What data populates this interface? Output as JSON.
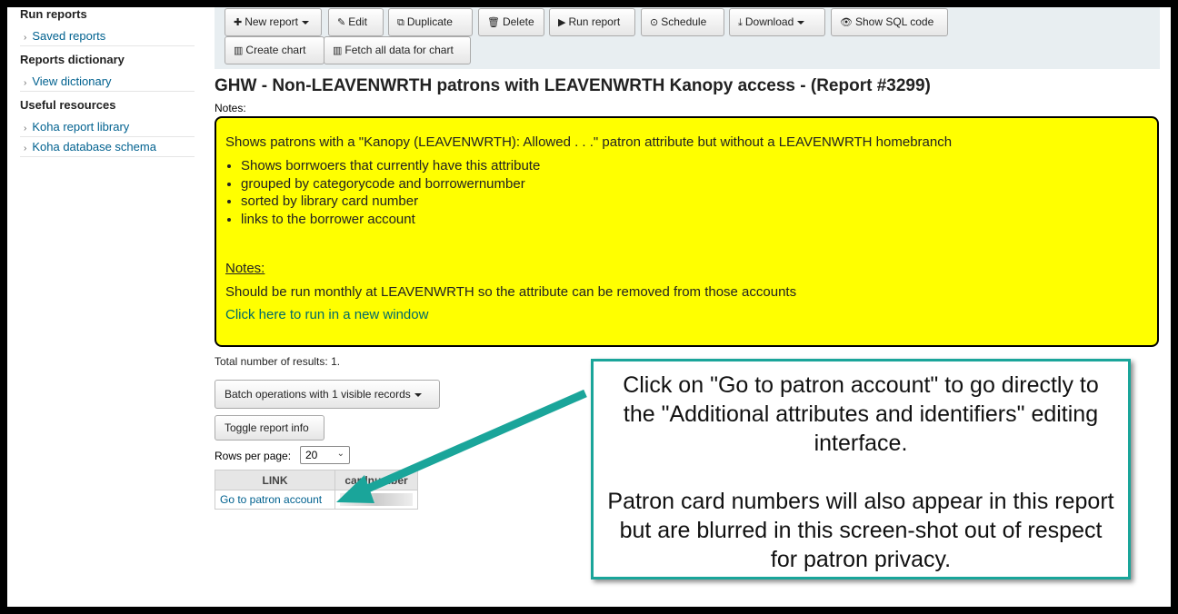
{
  "sidebar": {
    "sections": [
      {
        "heading": "Run reports",
        "items": [
          "Saved reports"
        ]
      },
      {
        "heading": "Reports dictionary",
        "items": [
          "View dictionary"
        ]
      },
      {
        "heading": "Useful resources",
        "items": [
          "Koha report library",
          "Koha database schema"
        ]
      }
    ]
  },
  "toolbar": {
    "new_report": "New report",
    "edit": "Edit",
    "duplicate": "Duplicate",
    "delete": "Delete",
    "run_report": "Run report",
    "schedule": "Schedule",
    "download": "Download",
    "show_sql": "Show SQL code",
    "create_chart": "Create chart",
    "fetch_all": "Fetch all data for chart"
  },
  "report": {
    "title": "GHW - Non-LEAVENWRTH patrons with LEAVENWRTH Kanopy access - (Report #3299)",
    "notes_label": "Notes:",
    "notes": {
      "intro": "Shows patrons with a \"Kanopy (LEAVENWRTH): Allowed . . .\" patron attribute but without a LEAVENWRTH homebranch",
      "bullets": [
        "Shows borrwoers that currently have this attribute",
        "grouped by categorycode and borrowernumber",
        "sorted by library card number",
        "links to the borrower account"
      ],
      "sub_heading": "Notes:",
      "run_note": "Should be run monthly at LEAVENWRTH so the attribute can be removed from those accounts",
      "link_text": "Click here to run in a new window"
    },
    "total_label": "Total number of results:",
    "total_value": "1.",
    "batch_button": "Batch operations with 1 visible records",
    "toggle_button": "Toggle report info",
    "rows_label": "Rows per page:",
    "rows_value": "20",
    "table": {
      "headers": [
        "LINK",
        "cardnumber"
      ],
      "rows": [
        [
          "Go to patron account",
          ""
        ]
      ]
    }
  },
  "callout": {
    "para1": "Click on \"Go to patron account\" to go directly to the \"Additional attributes and identifiers\" editing interface.",
    "para2": "Patron card numbers will also appear in this report but are blurred in this screen-shot out of respect for patron privacy."
  },
  "colors": {
    "notes_bg": "#ffff00",
    "callout_border": "#1aa59a",
    "link": "#00618f"
  }
}
